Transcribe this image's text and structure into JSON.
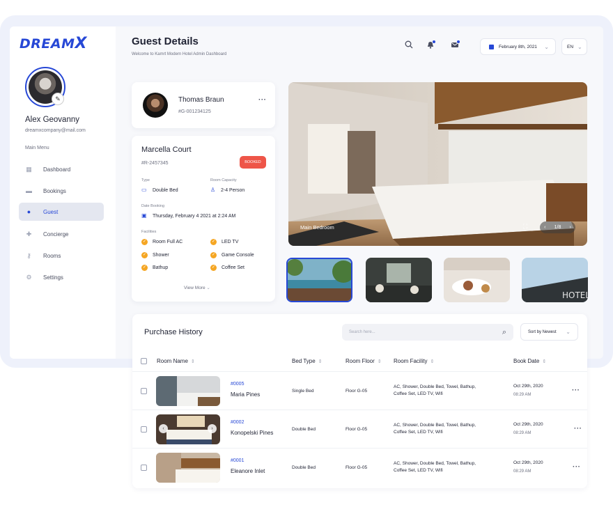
{
  "brand": {
    "logo_text": "DREAM",
    "logo_x": "X",
    "accent": "#2748d6",
    "danger": "#ee5548",
    "warning": "#f5a623"
  },
  "user": {
    "name": "Alex Geovanny",
    "email": "dreamxcompany@mail.com",
    "edit_icon": "pencil-icon"
  },
  "sidebar": {
    "menu_title": "Main Menu",
    "items": [
      {
        "label": "Dashboard",
        "icon": "dashboard-icon",
        "active": false
      },
      {
        "label": "Bookings",
        "icon": "briefcase-icon",
        "active": false
      },
      {
        "label": "Guest",
        "icon": "users-icon",
        "active": true
      },
      {
        "label": "Concierge",
        "icon": "puzzle-icon",
        "active": false
      },
      {
        "label": "Rooms",
        "icon": "key-icon",
        "active": false
      },
      {
        "label": "Settings",
        "icon": "gear-icon",
        "active": false
      }
    ]
  },
  "header": {
    "title": "Guest Details",
    "subtitle": "Welcome to Kamrt Modern Hotel Admin Dashboard",
    "date": "February 8th, 2021",
    "language": "EN"
  },
  "guest": {
    "name": "Thomas Braun",
    "id": "#G-001234125",
    "more": "···"
  },
  "room": {
    "name": "Marcella Court",
    "id": "#R-2457345",
    "status": "BOOKED",
    "type_label": "Type",
    "type_value": "Double Bed",
    "capacity_label": "Room Capacity",
    "capacity_value": "2-4 Person",
    "date_label": "Date Booking",
    "date_value": "Thursday, February 4 2021 at 2:24 AM",
    "facilities_label": "Facilities",
    "facilities": [
      "Room Full AC",
      "LED TV",
      "Shower",
      "Game Console",
      "Bathup",
      "Coffee Set"
    ],
    "view_more": "View More"
  },
  "gallery": {
    "caption": "Main Bedroom",
    "counter": "1/8",
    "prev": "‹",
    "next": "›"
  },
  "purchase_history": {
    "title": "Purchase History",
    "search_placeholder": "Search here...",
    "sort_label": "Sort by Newest",
    "columns": [
      "Room Name",
      "Bed Type",
      "Room Floor",
      "Room Facility",
      "Book Date"
    ],
    "rows": [
      {
        "code": "#0005",
        "name": "Maria Pines",
        "bed": "Single Bed",
        "floor": "Floor G-05",
        "facility_line1": "AC, Shower, Double Bed, Towel, Bathup,",
        "facility_line2": "Coffee Set, LED TV, Wifi",
        "date": "Oct 29th, 2020",
        "time": "08:29 AM"
      },
      {
        "code": "#0002",
        "name": "Konopelski Pines",
        "bed": "Double Bed",
        "floor": "Floor G-05",
        "facility_line1": "AC, Shower, Double Bed, Towel, Bathup,",
        "facility_line2": "Coffee Set, LED TV, Wifi",
        "date": "Oct 29th, 2020",
        "time": "08:29 AM"
      },
      {
        "code": "#0001",
        "name": "Eleanore Inlet",
        "bed": "Double Bed",
        "floor": "Floor G-05",
        "facility_line1": "AC, Shower, Double Bed, Towel, Bathup,",
        "facility_line2": "Coffee Set, LED TV, Wifi",
        "date": "Oct 29th, 2020",
        "time": "08:29 AM"
      }
    ]
  }
}
